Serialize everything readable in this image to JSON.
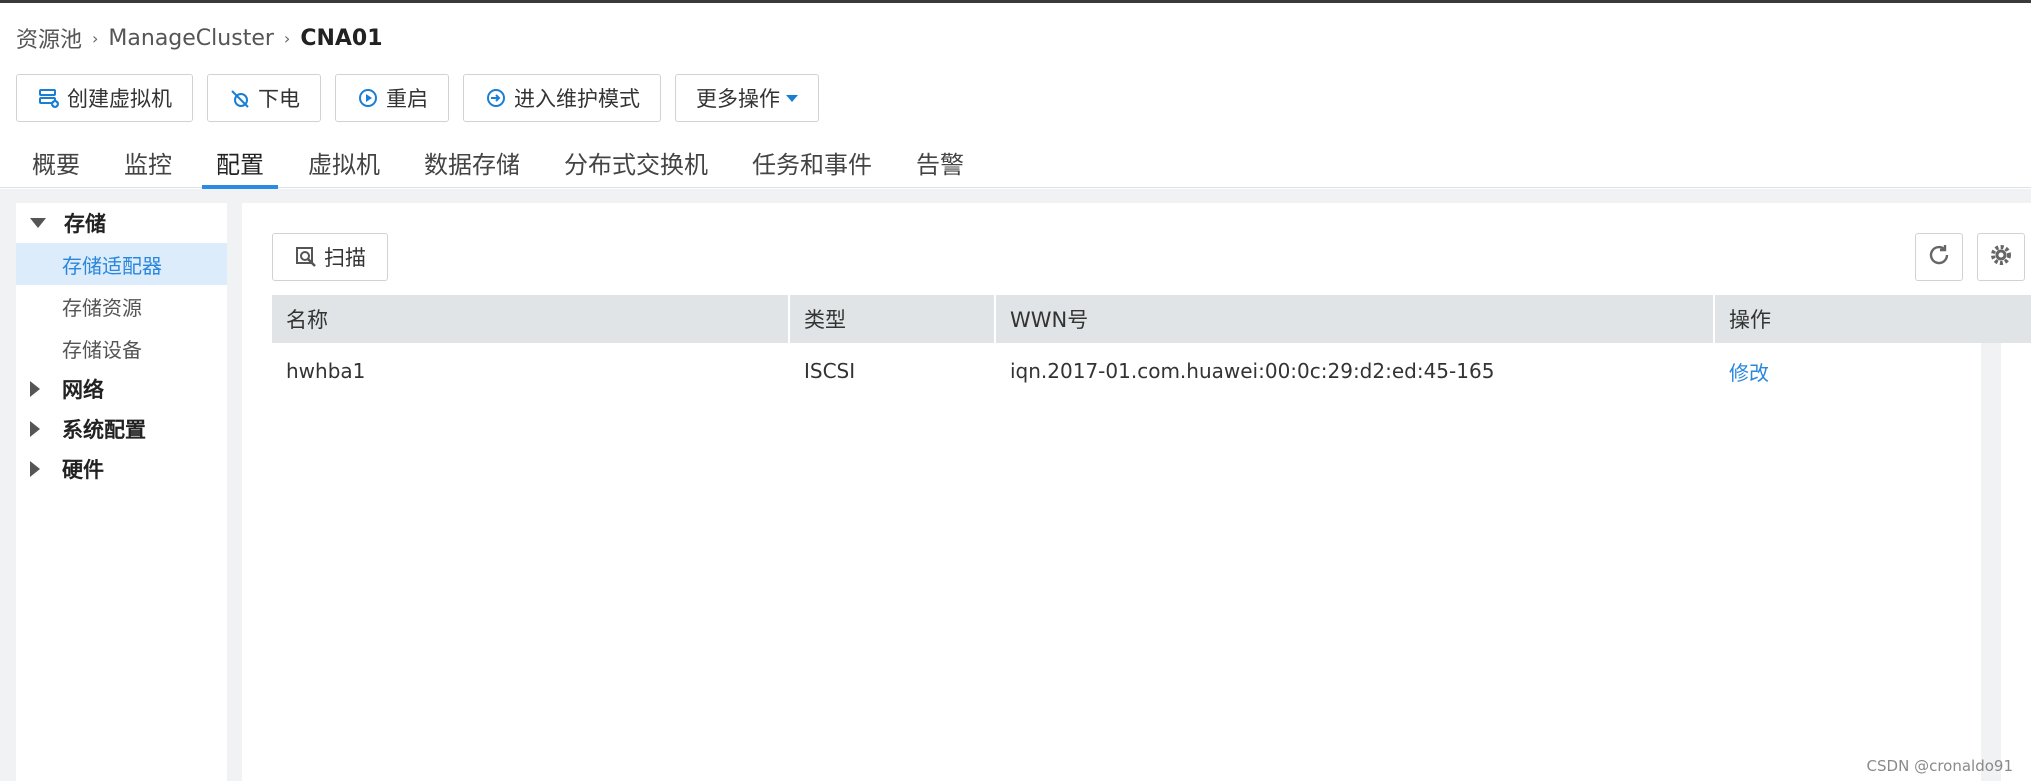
{
  "breadcrumb": {
    "items": [
      "资源池",
      "ManageCluster"
    ],
    "current": "CNA01"
  },
  "toolbar": {
    "create_vm": "创建虚拟机",
    "power_off": "下电",
    "restart": "重启",
    "maintenance": "进入维护模式",
    "more": "更多操作"
  },
  "tabs": [
    {
      "label": "概要",
      "active": false
    },
    {
      "label": "监控",
      "active": false
    },
    {
      "label": "配置",
      "active": true
    },
    {
      "label": "虚拟机",
      "active": false
    },
    {
      "label": "数据存储",
      "active": false
    },
    {
      "label": "分布式交换机",
      "active": false
    },
    {
      "label": "任务和事件",
      "active": false
    },
    {
      "label": "告警",
      "active": false
    }
  ],
  "sidebar": {
    "storage": {
      "label": "存储",
      "items": [
        "存储适配器",
        "存储资源",
        "存储设备"
      ]
    },
    "network": "网络",
    "system_config": "系统配置",
    "hardware": "硬件"
  },
  "main": {
    "scan_label": "扫描",
    "columns": [
      "名称",
      "类型",
      "WWN号",
      "操作"
    ],
    "rows": [
      {
        "name": "hwhba1",
        "type": "ISCSI",
        "wwn": "iqn.2017-01.com.huawei:00:0c:29:d2:ed:45-165",
        "action": "修改"
      }
    ]
  },
  "watermark": "CSDN @cronaldo91",
  "colors": {
    "accent": "#2b8ae6",
    "link": "#2a87dc",
    "selected_bg": "#dcecfb",
    "header_bg": "#e1e4e6"
  }
}
